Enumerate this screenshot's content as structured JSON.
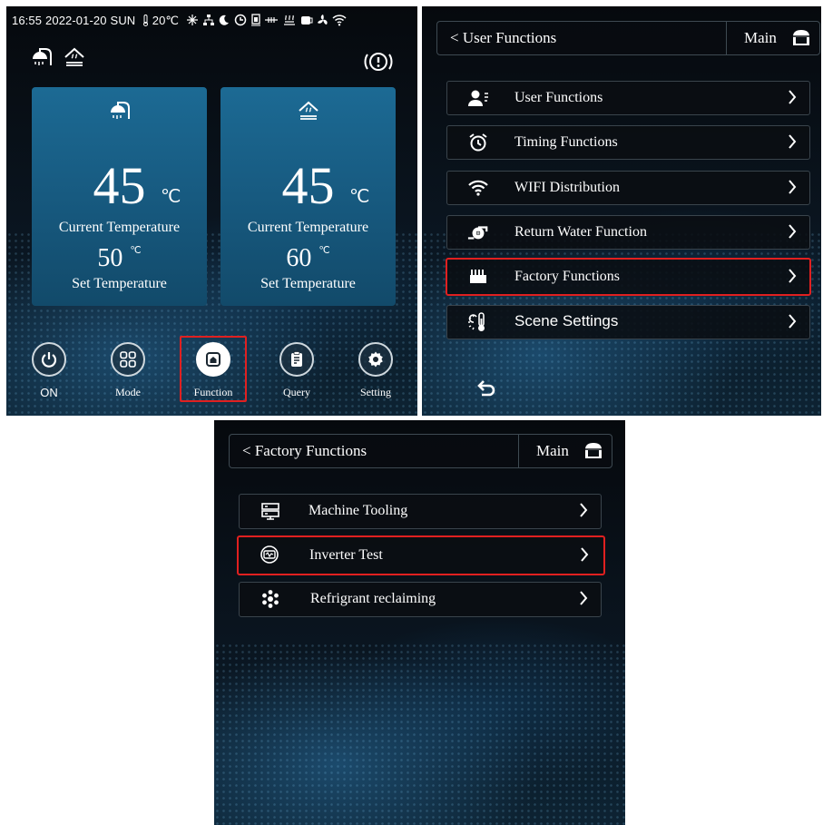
{
  "panel1": {
    "status": {
      "time": "16:55",
      "date": "2022-01-20",
      "day": "SUN",
      "ambient_temp": "20℃"
    },
    "cards": [
      {
        "temperature": "45",
        "unit": "℃",
        "current_label": "Current Temperature",
        "set_value": "50",
        "set_unit": "℃",
        "set_label": "Set Temperature"
      },
      {
        "temperature": "45",
        "unit": "℃",
        "current_label": "Current Temperature",
        "set_value": "60",
        "set_unit": "℃",
        "set_label": "Set Temperature"
      }
    ],
    "nav": [
      {
        "label": "ON",
        "icon": "power-icon"
      },
      {
        "label": "Mode",
        "icon": "grid-icon"
      },
      {
        "label": "Function",
        "icon": "home-icon",
        "highlighted": true
      },
      {
        "label": "Query",
        "icon": "clipboard-icon"
      },
      {
        "label": "Setting",
        "icon": "gear-icon"
      }
    ]
  },
  "panel2": {
    "header": {
      "back_label": "User Functions",
      "main_label": "Main"
    },
    "items": [
      {
        "label": "User Functions",
        "icon": "user-icon"
      },
      {
        "label": "Timing Functions",
        "icon": "alarm-clock-icon"
      },
      {
        "label": "WIFI Distribution",
        "icon": "wifi-icon"
      },
      {
        "label": "Return Water Function",
        "icon": "pump-icon"
      },
      {
        "label": "Factory Functions",
        "icon": "factory-icon",
        "highlighted": true
      },
      {
        "label": "Scene Settings",
        "icon": "scene-thermometer-icon"
      }
    ]
  },
  "panel3": {
    "header": {
      "back_label": "Factory Functions",
      "main_label": "Main"
    },
    "items": [
      {
        "label": "Machine Tooling",
        "icon": "machine-icon"
      },
      {
        "label": "Inverter Test",
        "icon": "inverter-icon",
        "highlighted": true
      },
      {
        "label": "Refrigrant reclaiming",
        "icon": "snowflake-icon"
      }
    ]
  },
  "colors": {
    "highlight": "#e02020",
    "card": "#1c6a94",
    "background": "#0a1520"
  }
}
